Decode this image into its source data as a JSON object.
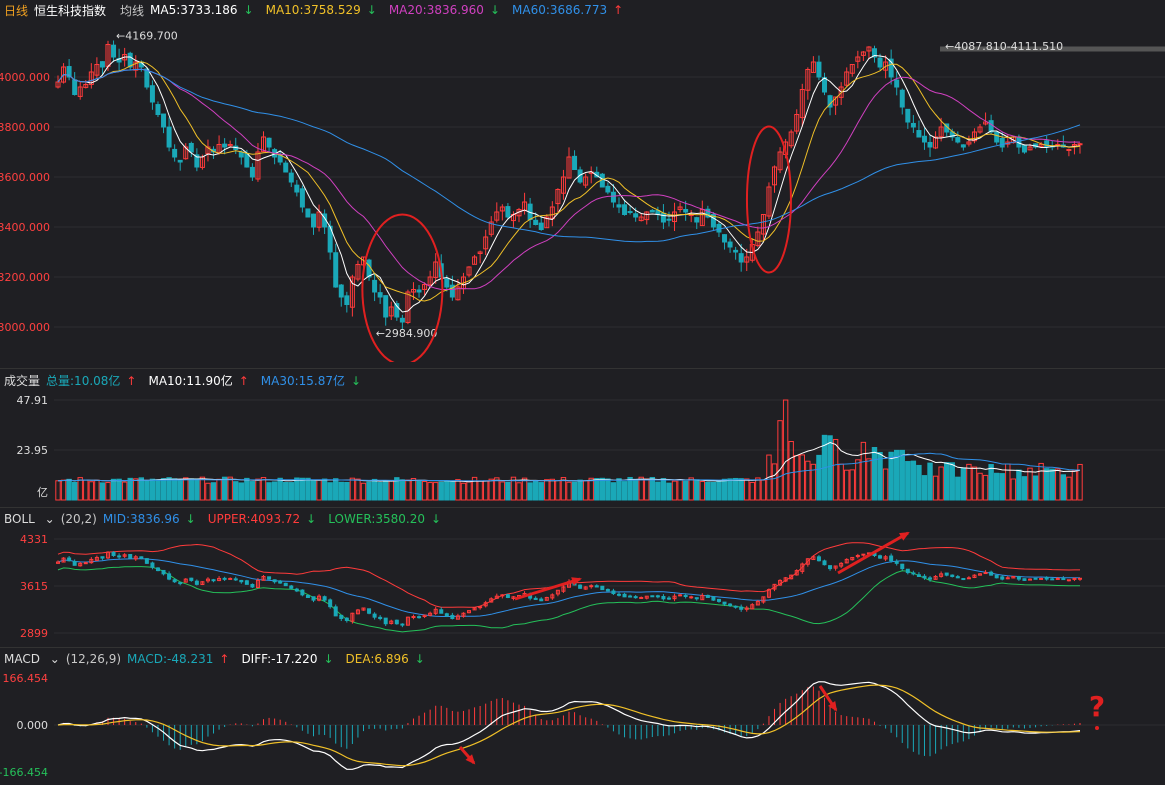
{
  "colors": {
    "up": "#ff3b3b",
    "down": "#1aa8b8",
    "ma5": "#ffffff",
    "ma10": "#f0c028",
    "ma20": "#d040c0",
    "ma60": "#3090e8",
    "boll_mid": "#3090e8",
    "boll_upper": "#ff3b3b",
    "boll_lower": "#25c05a",
    "macd_diff": "#ffffff",
    "macd_dea": "#f0c028",
    "accent": "#f0a020"
  },
  "main_header": {
    "period": "日线",
    "name": "恒生科技指数",
    "ma_label": "均线",
    "ma5": "MA5:3733.186",
    "ma5_arrow": "↓",
    "ma10": "MA10:3758.529",
    "ma10_arrow": "↓",
    "ma20": "MA20:3836.960",
    "ma20_arrow": "↓",
    "ma60": "MA60:3686.773",
    "ma60_arrow": "↑"
  },
  "vol_header": {
    "title": "成交量",
    "total": "总量:10.08亿",
    "total_arrow": "↑",
    "ma10": "MA10:11.90亿",
    "ma10_arrow": "↑",
    "ma30": "MA30:15.87亿",
    "ma30_arrow": "↓"
  },
  "boll_header": {
    "title": "BOLL",
    "params": "(20,2)",
    "mid": "MID:3836.96",
    "mid_arrow": "↓",
    "upper": "UPPER:4093.72",
    "upper_arrow": "↓",
    "lower": "LOWER:3580.20",
    "lower_arrow": "↓"
  },
  "macd_header": {
    "title": "MACD",
    "params": "(12,26,9)",
    "macd": "MACD:-48.231",
    "macd_arrow": "↑",
    "diff": "DIFF:-17.220",
    "diff_arrow": "↓",
    "dea": "DEA:6.896",
    "dea_arrow": "↓"
  },
  "chart_data": [
    {
      "type": "candlestick",
      "name": "main",
      "y_ticks": [
        "4000.000",
        "3800.000",
        "3600.000",
        "3400.000",
        "3200.000",
        "3000.000"
      ],
      "ylim": [
        2900,
        4180
      ],
      "annotations": {
        "high": "4169.700",
        "low": "2984.900",
        "right": "4087.810-4111.510"
      },
      "x": [
        0,
        1,
        2,
        3,
        4,
        5,
        6,
        7,
        8,
        9,
        10,
        11,
        12,
        13,
        14,
        15,
        16,
        17,
        18,
        19,
        20,
        21,
        22,
        23,
        24,
        25,
        26,
        27,
        28,
        29,
        30,
        31,
        32,
        33,
        34,
        35,
        36,
        37,
        38,
        39,
        40,
        41,
        42,
        43,
        44,
        45,
        46,
        47,
        48,
        49,
        50,
        51,
        52,
        53,
        54,
        55,
        56,
        57,
        58,
        59,
        60,
        61,
        62,
        63,
        64,
        65,
        66,
        67,
        68,
        69,
        70,
        71,
        72,
        73,
        74,
        75,
        76,
        77,
        78,
        79,
        80,
        81,
        82,
        83,
        84,
        85,
        86,
        87,
        88,
        89,
        90,
        91,
        92,
        93,
        94,
        95,
        96,
        97,
        98,
        99,
        100,
        101,
        102,
        103,
        104,
        105,
        106,
        107,
        108,
        109,
        110,
        111,
        112,
        113,
        114,
        115,
        116,
        117,
        118,
        119,
        120,
        121,
        122,
        123,
        124,
        125,
        126,
        127,
        128,
        129,
        130,
        131,
        132,
        133,
        134,
        135,
        136,
        137,
        138,
        139,
        140,
        141,
        142,
        143,
        144,
        145,
        146,
        147,
        148,
        149,
        150,
        151,
        152,
        153,
        154,
        155,
        156,
        157,
        158,
        159,
        160,
        161,
        162,
        163,
        164,
        165,
        166,
        167,
        168,
        169,
        170,
        171,
        172,
        173,
        174,
        175,
        176,
        177,
        178,
        179,
        180,
        181,
        182,
        183,
        184
      ],
      "close": [
        3980,
        4040,
        4000,
        3930,
        3960,
        3970,
        4020,
        4050,
        4040,
        4130,
        4080,
        4060,
        4090,
        4040,
        4060,
        4040,
        3960,
        3900,
        3850,
        3800,
        3720,
        3680,
        3660,
        3720,
        3700,
        3640,
        3680,
        3720,
        3700,
        3730,
        3720,
        3730,
        3710,
        3680,
        3640,
        3600,
        3700,
        3760,
        3720,
        3680,
        3660,
        3620,
        3580,
        3540,
        3480,
        3440,
        3400,
        3460,
        3400,
        3300,
        3160,
        3120,
        3090,
        3200,
        3250,
        3280,
        3200,
        3140,
        3120,
        3040,
        3080,
        3040,
        3020,
        3140,
        3150,
        3140,
        3170,
        3200,
        3260,
        3200,
        3160,
        3120,
        3160,
        3200,
        3240,
        3280,
        3300,
        3360,
        3420,
        3460,
        3480,
        3440,
        3450,
        3470,
        3500,
        3430,
        3410,
        3390,
        3440,
        3480,
        3550,
        3600,
        3680,
        3630,
        3580,
        3600,
        3620,
        3600,
        3560,
        3540,
        3500,
        3480,
        3450,
        3460,
        3440,
        3440,
        3460,
        3460,
        3450,
        3420,
        3430,
        3460,
        3480,
        3460,
        3450,
        3420,
        3470,
        3440,
        3400,
        3380,
        3340,
        3320,
        3300,
        3260,
        3280,
        3330,
        3380,
        3450,
        3560,
        3640,
        3700,
        3740,
        3780,
        3850,
        3950,
        4030,
        4060,
        4000,
        3940,
        3880,
        3920,
        3960,
        4020,
        4050,
        4080,
        4100,
        4120,
        4080,
        4040,
        4060,
        4000,
        3960,
        3880,
        3820,
        3800,
        3760,
        3740,
        3720,
        3760,
        3800,
        3780,
        3760,
        3740,
        3720,
        3740,
        3780,
        3800,
        3820,
        3780,
        3740,
        3720,
        3740,
        3760,
        3720,
        3700,
        3720,
        3720,
        3730,
        3720,
        3720,
        3730,
        3720,
        3710,
        3730,
        3733
      ]
    }
  ]
}
